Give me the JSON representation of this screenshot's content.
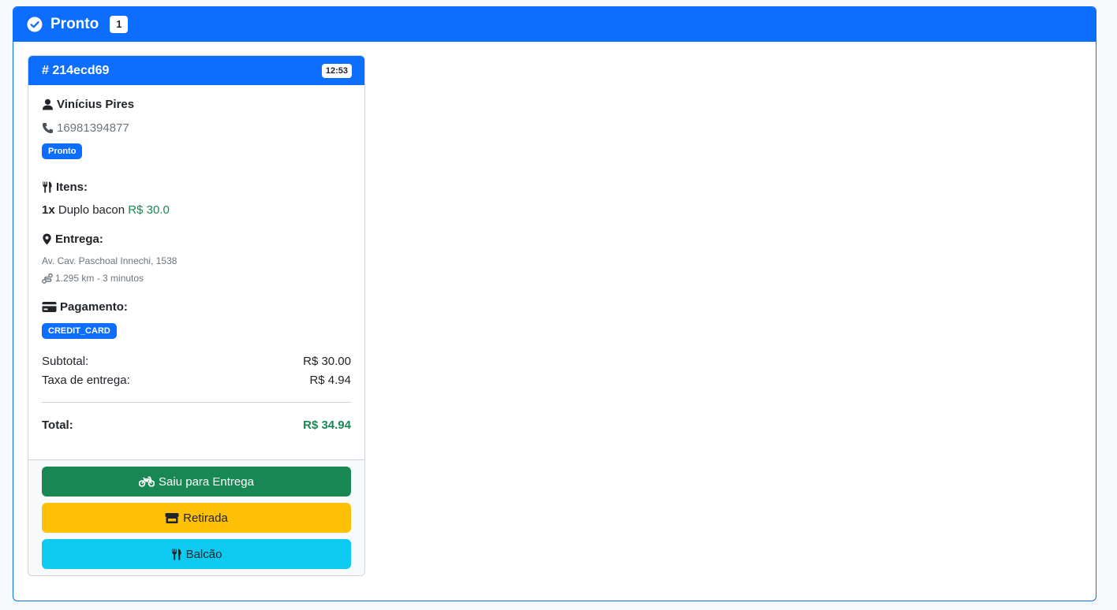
{
  "column": {
    "title": "Pronto",
    "count": "1",
    "header_color": "#0d6efd",
    "header_icon": "check-circle-icon"
  },
  "order": {
    "id": "# 214ecd69",
    "time": "12:53",
    "customer_name": "Vinícius Pires",
    "phone": "16981394877",
    "status": "Pronto",
    "items_label": "Itens:",
    "items": [
      {
        "qty": "1x",
        "name": "Duplo bacon",
        "price": "R$ 30.0"
      }
    ],
    "delivery_label": "Entrega:",
    "address": "Av. Cav. Paschoal Innechi, 1538",
    "distance": "1.295 km - 3 minutos",
    "payment_label": "Pagamento:",
    "payment_method": "CREDIT_CARD",
    "subtotal_label": "Subtotal:",
    "subtotal": "R$ 30.00",
    "fee_label": "Taxa de entrega:",
    "fee": "R$ 4.94",
    "total_label": "Total:",
    "total": "R$ 34.94"
  },
  "actions": {
    "delivery": "Saiu para Entrega",
    "pickup": "Retirada",
    "counter": "Balcão"
  },
  "colors": {
    "primary": "#0d6efd",
    "success": "#198754",
    "warning": "#ffc107",
    "info": "#0dcaf0"
  }
}
